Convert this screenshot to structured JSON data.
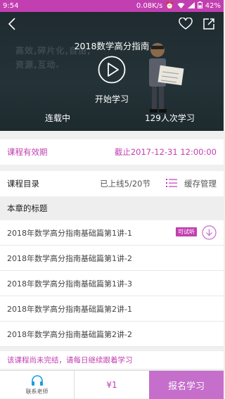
{
  "status_bar": {
    "time": "9:54",
    "network_speed": "0.08K/s",
    "battery": "42%"
  },
  "hero": {
    "title": "2018数学高分指南",
    "background_slogan_line1": "高效,碎片化,自由,",
    "background_slogan_line2": "资源,互动.",
    "start_label": "开始学习",
    "serial_status": "连载中",
    "learners": "129人次学习"
  },
  "validity": {
    "label": "课程有效期",
    "value": "截止2017-12-31 12:00:00"
  },
  "catalog": {
    "label": "课程目录",
    "online_count": "已上线5/20节",
    "cache_label": "缓存管理"
  },
  "chapter": {
    "title": "本章的标题"
  },
  "lessons": [
    {
      "title": "2018年数学高分指南基础篇第1讲-1",
      "badge": "可试听",
      "downloadable": true
    },
    {
      "title": "2018年数学高分指南基础篇第1讲-2"
    },
    {
      "title": "2018年数学高分指南基础篇第1讲-3"
    },
    {
      "title": "2018年数学高分指南基础篇第2讲-1"
    },
    {
      "title": "2018年数学高分指南基础篇第2讲-2"
    }
  ],
  "notice": "该课程尚未完结，请每日继续跟着学习",
  "bottom_bar": {
    "contact_label": "联系老师",
    "price": "¥1",
    "enroll_label": "报名学习"
  },
  "colors": {
    "accent": "#c13fb0",
    "enroll_button": "#c56ecb",
    "hero_bg": "#243338"
  }
}
